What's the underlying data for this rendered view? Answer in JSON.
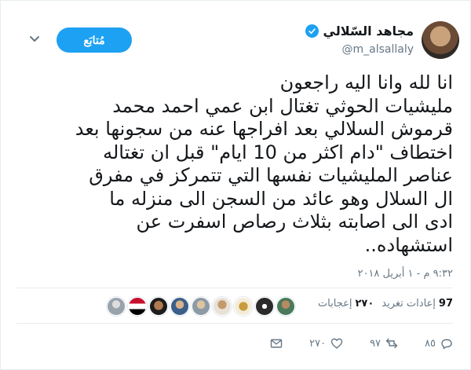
{
  "tweet": {
    "author": {
      "name": "مجاهد السّلالي",
      "handle": "@m_alsallaly",
      "verified": true
    },
    "follow_label": "مُتابَع",
    "text_lines": [
      "انا لله وانا اليه راجعون",
      "مليشيات الحوثي تغتال ابن عمي احمد محمد",
      "قرموش السلالي بعد افراجها عنه من سجونها بعد",
      "اختطاف \"دام اكثر من 10 ايام\" قبل ان تغتاله",
      "عناصر المليشيات نفسها التي تتمركز في مفرق",
      "ال السلال وهو عائد من السجن الى منزله ما",
      "ادى الى اصابته بثلاث رصاص اسفرت عن",
      "استشهاده.."
    ],
    "timestamp": "٩:٣٢ م - ١ أبريل ٢٠١٨",
    "stats": {
      "retweets_count": "97",
      "retweets_label": "إعادات تغريد",
      "likes_count": "٢٧٠",
      "likes_label": "إعجابات"
    },
    "actions": {
      "reply_count": "٨٥",
      "retweet_count": "٩٧",
      "like_count": "٢٧٠"
    },
    "colors": {
      "accent": "#1da1f2",
      "text": "#14171a",
      "muted": "#657786",
      "divider": "#e6ecf0"
    },
    "icons": [
      "verified-icon",
      "caret-down-icon",
      "reply-icon",
      "retweet-icon",
      "heart-icon",
      "mail-icon"
    ]
  }
}
